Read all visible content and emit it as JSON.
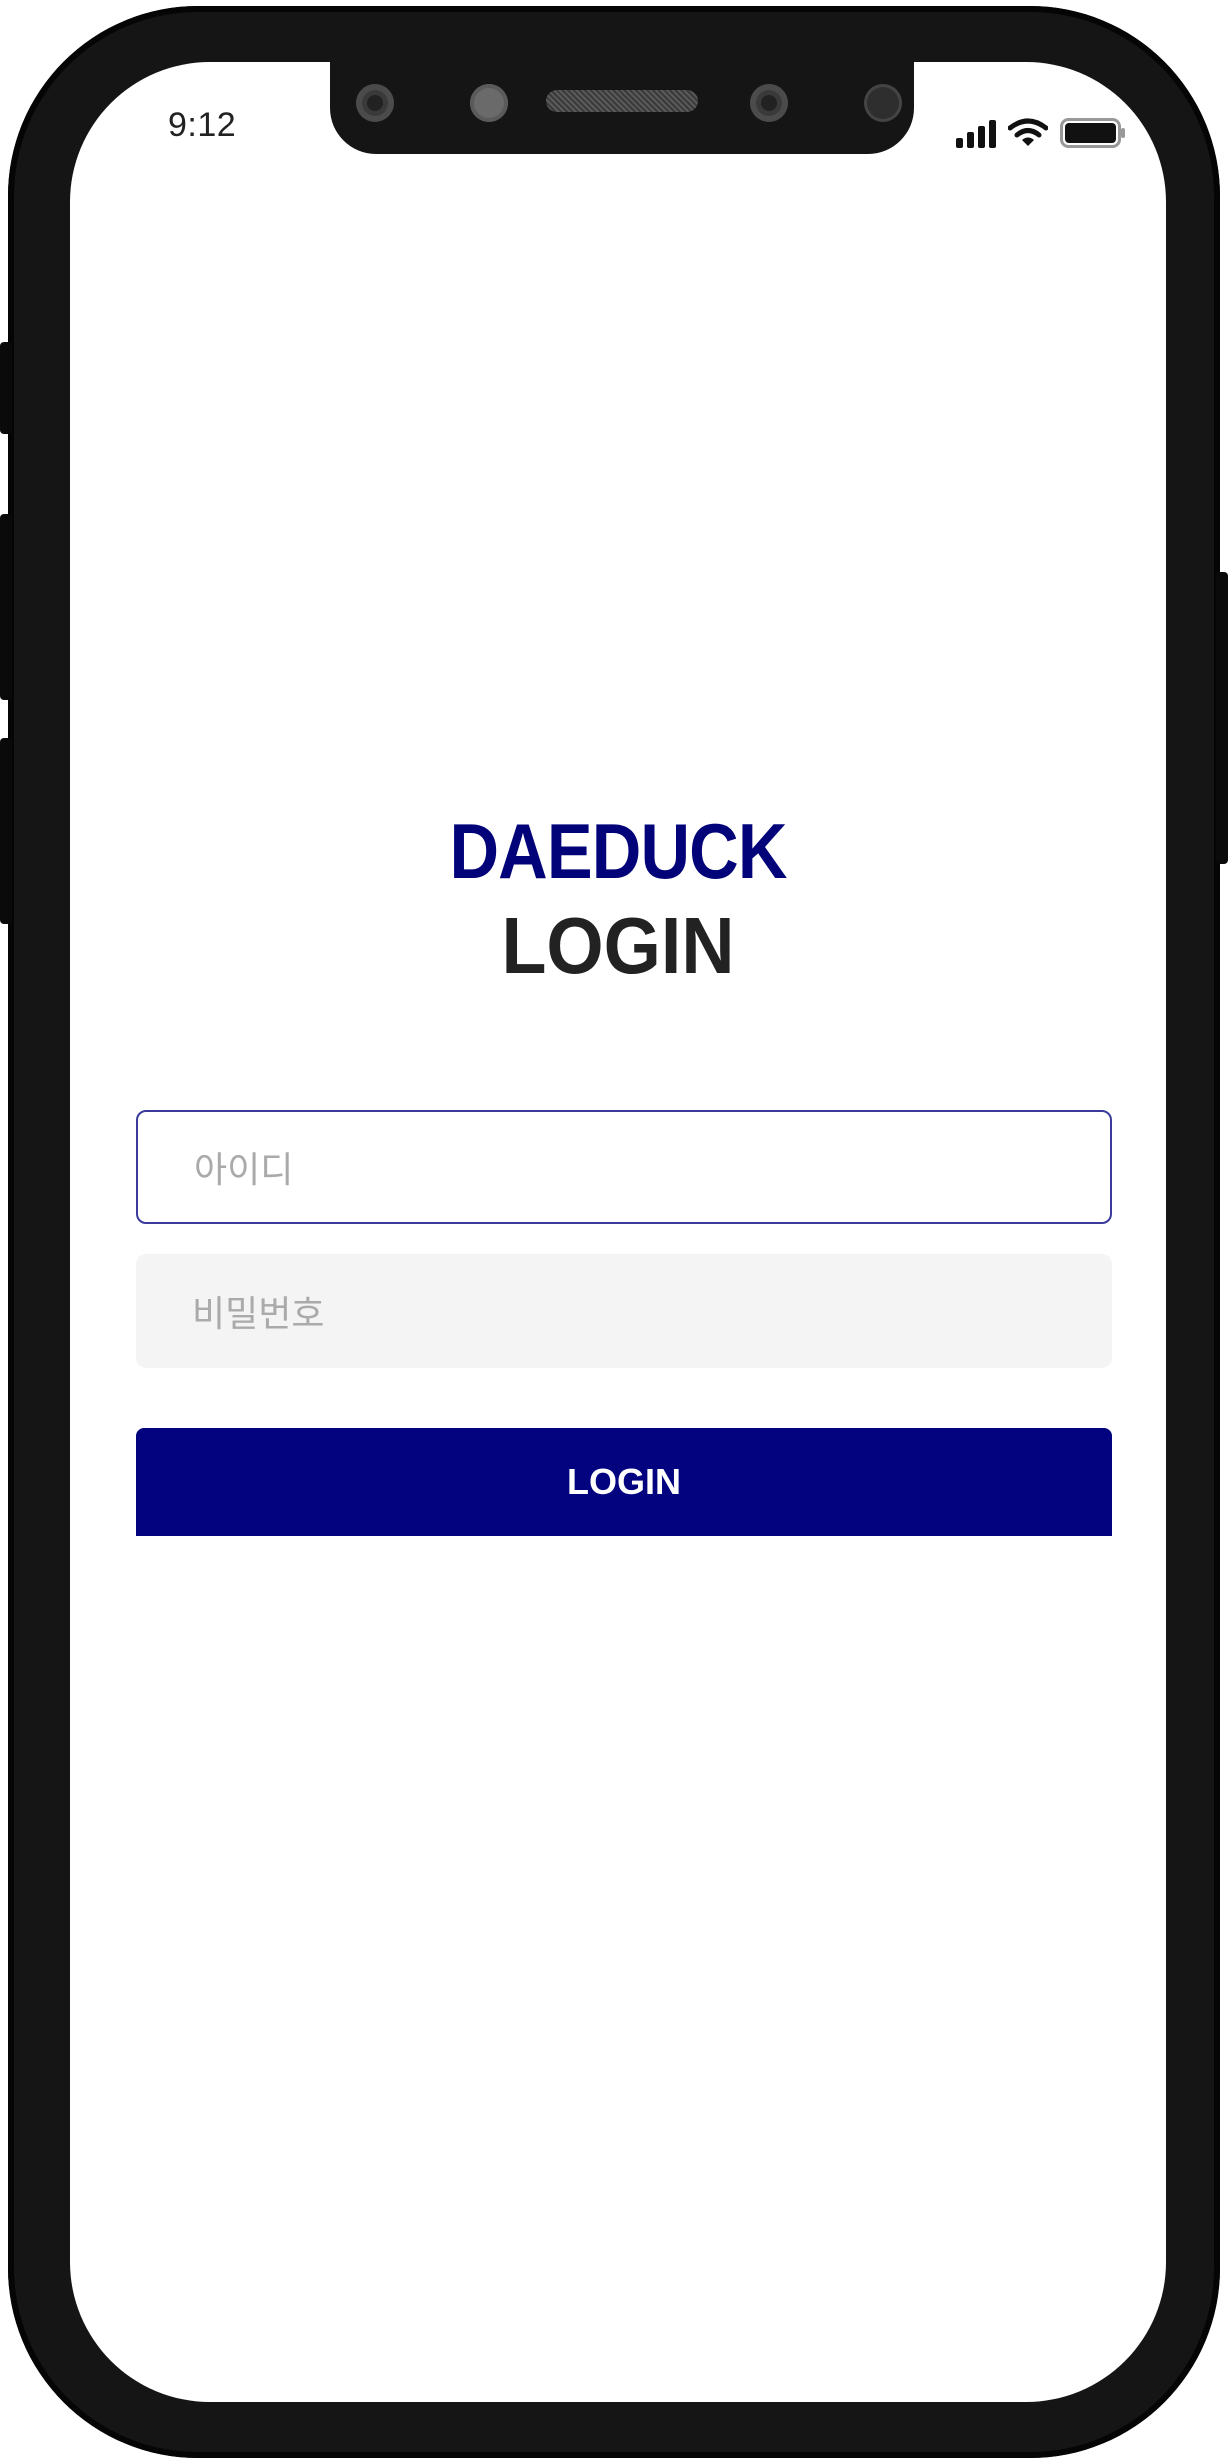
{
  "status_bar": {
    "time": "9:12",
    "icons": [
      "signal-icon",
      "wifi-icon",
      "battery-icon"
    ]
  },
  "brand": {
    "name": "DAEDUCK",
    "color": "#030379"
  },
  "login": {
    "heading": "LOGIN",
    "id_placeholder": "아이디",
    "password_placeholder": "비밀번호",
    "button_label": "LOGIN",
    "button_color": "#030380"
  }
}
